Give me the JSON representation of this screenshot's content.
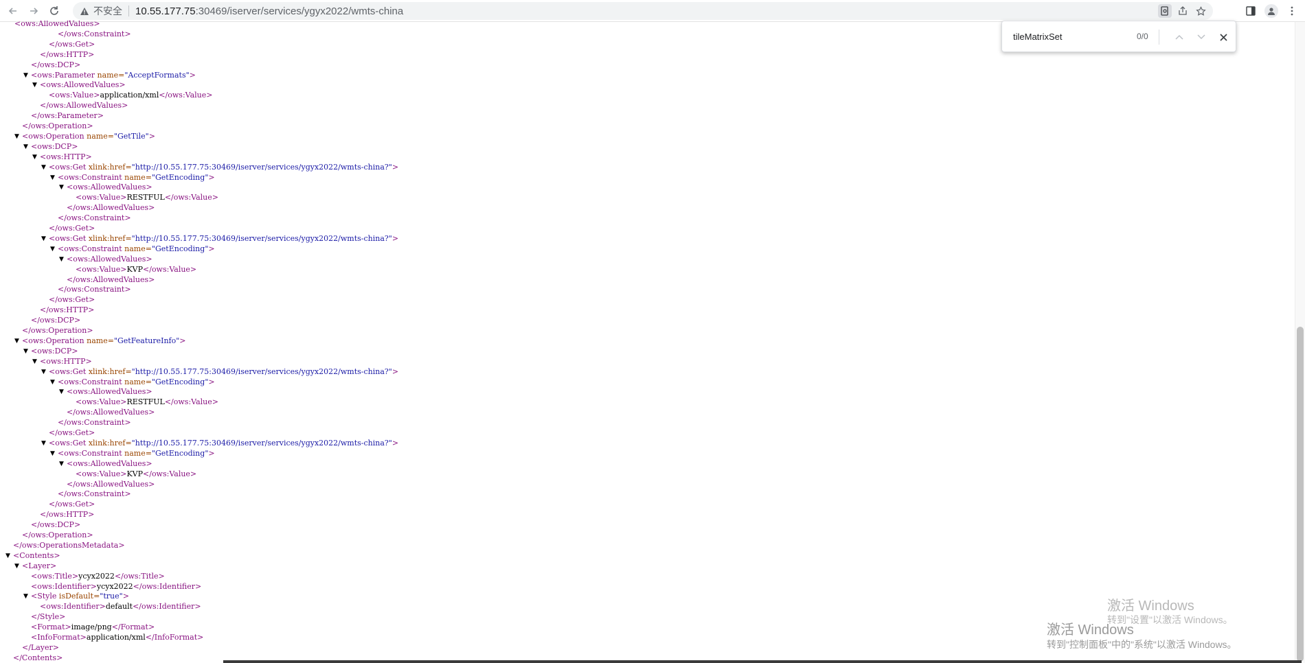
{
  "toolbar": {
    "insecure_label": "不安全",
    "url_host": "10.55.177.75",
    "url_path": ":30469/iserver/services/ygyx2022/wmts-china"
  },
  "find": {
    "query": "tileMatrixSet",
    "count": "0/0"
  },
  "watermark": {
    "title1": "激活 Windows",
    "sub1": "转到\"设置\"以激活 Windows。",
    "title2": "激活 Windows",
    "sub2": "转到\"控制面板\"中的\"系统\"以激活 Windows。"
  },
  "xml_lines": [
    {
      "indent": 0,
      "toggle": false,
      "parts": [
        [
          "t",
          "        <ows:AllowedValues>"
        ]
      ]
    },
    {
      "indent": 7,
      "toggle": false,
      "parts": [
        [
          "t",
          "</ows:Constraint>"
        ]
      ]
    },
    {
      "indent": 6,
      "toggle": false,
      "parts": [
        [
          "t",
          "</ows:Get>"
        ]
      ]
    },
    {
      "indent": 5,
      "toggle": false,
      "parts": [
        [
          "t",
          "</ows:HTTP>"
        ]
      ]
    },
    {
      "indent": 4,
      "toggle": false,
      "parts": [
        [
          "t",
          "</ows:DCP>"
        ]
      ]
    },
    {
      "indent": 4,
      "toggle": true,
      "parts": [
        [
          "t",
          "<ows:Parameter "
        ],
        [
          "a",
          "name="
        ],
        [
          "v",
          "\"AcceptFormats\""
        ],
        [
          "t",
          ">"
        ]
      ]
    },
    {
      "indent": 5,
      "toggle": true,
      "parts": [
        [
          "t",
          "<ows:AllowedValues>"
        ]
      ]
    },
    {
      "indent": 6,
      "toggle": false,
      "parts": [
        [
          "t",
          "<ows:Value>"
        ],
        [
          "x",
          "application/xml"
        ],
        [
          "t",
          "</ows:Value>"
        ]
      ]
    },
    {
      "indent": 5,
      "toggle": false,
      "parts": [
        [
          "t",
          "</ows:AllowedValues>"
        ]
      ]
    },
    {
      "indent": 4,
      "toggle": false,
      "parts": [
        [
          "t",
          "</ows:Parameter>"
        ]
      ]
    },
    {
      "indent": 3,
      "toggle": false,
      "parts": [
        [
          "t",
          "</ows:Operation>"
        ]
      ]
    },
    {
      "indent": 3,
      "toggle": true,
      "parts": [
        [
          "t",
          "<ows:Operation "
        ],
        [
          "a",
          "name="
        ],
        [
          "v",
          "\"GetTile\""
        ],
        [
          "t",
          ">"
        ]
      ]
    },
    {
      "indent": 4,
      "toggle": true,
      "parts": [
        [
          "t",
          "<ows:DCP>"
        ]
      ]
    },
    {
      "indent": 5,
      "toggle": true,
      "parts": [
        [
          "t",
          "<ows:HTTP>"
        ]
      ]
    },
    {
      "indent": 6,
      "toggle": true,
      "parts": [
        [
          "t",
          "<ows:Get "
        ],
        [
          "a",
          "xlink:href="
        ],
        [
          "v",
          "\"http://10.55.177.75:30469/iserver/services/ygyx2022/wmts-china?\""
        ],
        [
          "t",
          ">"
        ]
      ]
    },
    {
      "indent": 7,
      "toggle": true,
      "parts": [
        [
          "t",
          "<ows:Constraint "
        ],
        [
          "a",
          "name="
        ],
        [
          "v",
          "\"GetEncoding\""
        ],
        [
          "t",
          ">"
        ]
      ]
    },
    {
      "indent": 8,
      "toggle": true,
      "parts": [
        [
          "t",
          "<ows:AllowedValues>"
        ]
      ]
    },
    {
      "indent": 9,
      "toggle": false,
      "parts": [
        [
          "t",
          "<ows:Value>"
        ],
        [
          "x",
          "RESTFUL"
        ],
        [
          "t",
          "</ows:Value>"
        ]
      ]
    },
    {
      "indent": 8,
      "toggle": false,
      "parts": [
        [
          "t",
          "</ows:AllowedValues>"
        ]
      ]
    },
    {
      "indent": 7,
      "toggle": false,
      "parts": [
        [
          "t",
          "</ows:Constraint>"
        ]
      ]
    },
    {
      "indent": 6,
      "toggle": false,
      "parts": [
        [
          "t",
          "</ows:Get>"
        ]
      ]
    },
    {
      "indent": 6,
      "toggle": true,
      "parts": [
        [
          "t",
          "<ows:Get "
        ],
        [
          "a",
          "xlink:href="
        ],
        [
          "v",
          "\"http://10.55.177.75:30469/iserver/services/ygyx2022/wmts-china?\""
        ],
        [
          "t",
          ">"
        ]
      ]
    },
    {
      "indent": 7,
      "toggle": true,
      "parts": [
        [
          "t",
          "<ows:Constraint "
        ],
        [
          "a",
          "name="
        ],
        [
          "v",
          "\"GetEncoding\""
        ],
        [
          "t",
          ">"
        ]
      ]
    },
    {
      "indent": 8,
      "toggle": true,
      "parts": [
        [
          "t",
          "<ows:AllowedValues>"
        ]
      ]
    },
    {
      "indent": 9,
      "toggle": false,
      "parts": [
        [
          "t",
          "<ows:Value>"
        ],
        [
          "x",
          "KVP"
        ],
        [
          "t",
          "</ows:Value>"
        ]
      ]
    },
    {
      "indent": 8,
      "toggle": false,
      "parts": [
        [
          "t",
          "</ows:AllowedValues>"
        ]
      ]
    },
    {
      "indent": 7,
      "toggle": false,
      "parts": [
        [
          "t",
          "</ows:Constraint>"
        ]
      ]
    },
    {
      "indent": 6,
      "toggle": false,
      "parts": [
        [
          "t",
          "</ows:Get>"
        ]
      ]
    },
    {
      "indent": 5,
      "toggle": false,
      "parts": [
        [
          "t",
          "</ows:HTTP>"
        ]
      ]
    },
    {
      "indent": 4,
      "toggle": false,
      "parts": [
        [
          "t",
          "</ows:DCP>"
        ]
      ]
    },
    {
      "indent": 3,
      "toggle": false,
      "parts": [
        [
          "t",
          "</ows:Operation>"
        ]
      ]
    },
    {
      "indent": 3,
      "toggle": true,
      "parts": [
        [
          "t",
          "<ows:Operation "
        ],
        [
          "a",
          "name="
        ],
        [
          "v",
          "\"GetFeatureInfo\""
        ],
        [
          "t",
          ">"
        ]
      ]
    },
    {
      "indent": 4,
      "toggle": true,
      "parts": [
        [
          "t",
          "<ows:DCP>"
        ]
      ]
    },
    {
      "indent": 5,
      "toggle": true,
      "parts": [
        [
          "t",
          "<ows:HTTP>"
        ]
      ]
    },
    {
      "indent": 6,
      "toggle": true,
      "parts": [
        [
          "t",
          "<ows:Get "
        ],
        [
          "a",
          "xlink:href="
        ],
        [
          "v",
          "\"http://10.55.177.75:30469/iserver/services/ygyx2022/wmts-china?\""
        ],
        [
          "t",
          ">"
        ]
      ]
    },
    {
      "indent": 7,
      "toggle": true,
      "parts": [
        [
          "t",
          "<ows:Constraint "
        ],
        [
          "a",
          "name="
        ],
        [
          "v",
          "\"GetEncoding\""
        ],
        [
          "t",
          ">"
        ]
      ]
    },
    {
      "indent": 8,
      "toggle": true,
      "parts": [
        [
          "t",
          "<ows:AllowedValues>"
        ]
      ]
    },
    {
      "indent": 9,
      "toggle": false,
      "parts": [
        [
          "t",
          "<ows:Value>"
        ],
        [
          "x",
          "RESTFUL"
        ],
        [
          "t",
          "</ows:Value>"
        ]
      ]
    },
    {
      "indent": 8,
      "toggle": false,
      "parts": [
        [
          "t",
          "</ows:AllowedValues>"
        ]
      ]
    },
    {
      "indent": 7,
      "toggle": false,
      "parts": [
        [
          "t",
          "</ows:Constraint>"
        ]
      ]
    },
    {
      "indent": 6,
      "toggle": false,
      "parts": [
        [
          "t",
          "</ows:Get>"
        ]
      ]
    },
    {
      "indent": 6,
      "toggle": true,
      "parts": [
        [
          "t",
          "<ows:Get "
        ],
        [
          "a",
          "xlink:href="
        ],
        [
          "v",
          "\"http://10.55.177.75:30469/iserver/services/ygyx2022/wmts-china?\""
        ],
        [
          "t",
          ">"
        ]
      ]
    },
    {
      "indent": 7,
      "toggle": true,
      "parts": [
        [
          "t",
          "<ows:Constraint "
        ],
        [
          "a",
          "name="
        ],
        [
          "v",
          "\"GetEncoding\""
        ],
        [
          "t",
          ">"
        ]
      ]
    },
    {
      "indent": 8,
      "toggle": true,
      "parts": [
        [
          "t",
          "<ows:AllowedValues>"
        ]
      ]
    },
    {
      "indent": 9,
      "toggle": false,
      "parts": [
        [
          "t",
          "<ows:Value>"
        ],
        [
          "x",
          "KVP"
        ],
        [
          "t",
          "</ows:Value>"
        ]
      ]
    },
    {
      "indent": 8,
      "toggle": false,
      "parts": [
        [
          "t",
          "</ows:AllowedValues>"
        ]
      ]
    },
    {
      "indent": 7,
      "toggle": false,
      "parts": [
        [
          "t",
          "</ows:Constraint>"
        ]
      ]
    },
    {
      "indent": 6,
      "toggle": false,
      "parts": [
        [
          "t",
          "</ows:Get>"
        ]
      ]
    },
    {
      "indent": 5,
      "toggle": false,
      "parts": [
        [
          "t",
          "</ows:HTTP>"
        ]
      ]
    },
    {
      "indent": 4,
      "toggle": false,
      "parts": [
        [
          "t",
          "</ows:DCP>"
        ]
      ]
    },
    {
      "indent": 3,
      "toggle": false,
      "parts": [
        [
          "t",
          "</ows:Operation>"
        ]
      ]
    },
    {
      "indent": 2,
      "toggle": false,
      "parts": [
        [
          "t",
          "</ows:OperationsMetadata>"
        ]
      ]
    },
    {
      "indent": 2,
      "toggle": true,
      "parts": [
        [
          "t",
          "<Contents>"
        ]
      ]
    },
    {
      "indent": 3,
      "toggle": true,
      "parts": [
        [
          "t",
          "<Layer>"
        ]
      ]
    },
    {
      "indent": 4,
      "toggle": false,
      "parts": [
        [
          "t",
          "<ows:Title>"
        ],
        [
          "x",
          "ycyx2022"
        ],
        [
          "t",
          "</ows:Title>"
        ]
      ]
    },
    {
      "indent": 4,
      "toggle": false,
      "parts": [
        [
          "t",
          "<ows:Identifier>"
        ],
        [
          "x",
          "ycyx2022"
        ],
        [
          "t",
          "</ows:Identifier>"
        ]
      ]
    },
    {
      "indent": 4,
      "toggle": true,
      "parts": [
        [
          "t",
          "<Style "
        ],
        [
          "a",
          "isDefault="
        ],
        [
          "v",
          "\"true\""
        ],
        [
          "t",
          ">"
        ]
      ]
    },
    {
      "indent": 5,
      "toggle": false,
      "parts": [
        [
          "t",
          "<ows:Identifier>"
        ],
        [
          "x",
          "default"
        ],
        [
          "t",
          "</ows:Identifier>"
        ]
      ]
    },
    {
      "indent": 4,
      "toggle": false,
      "parts": [
        [
          "t",
          "</Style>"
        ]
      ]
    },
    {
      "indent": 4,
      "toggle": false,
      "parts": [
        [
          "t",
          "<Format>"
        ],
        [
          "x",
          "image/png"
        ],
        [
          "t",
          "</Format>"
        ]
      ]
    },
    {
      "indent": 4,
      "toggle": false,
      "parts": [
        [
          "t",
          "<InfoFormat>"
        ],
        [
          "x",
          "application/xml"
        ],
        [
          "t",
          "</InfoFormat>"
        ]
      ]
    },
    {
      "indent": 3,
      "toggle": false,
      "parts": [
        [
          "t",
          "</Layer>"
        ]
      ]
    },
    {
      "indent": 2,
      "toggle": false,
      "parts": [
        [
          "t",
          "</Contents>"
        ]
      ]
    }
  ]
}
